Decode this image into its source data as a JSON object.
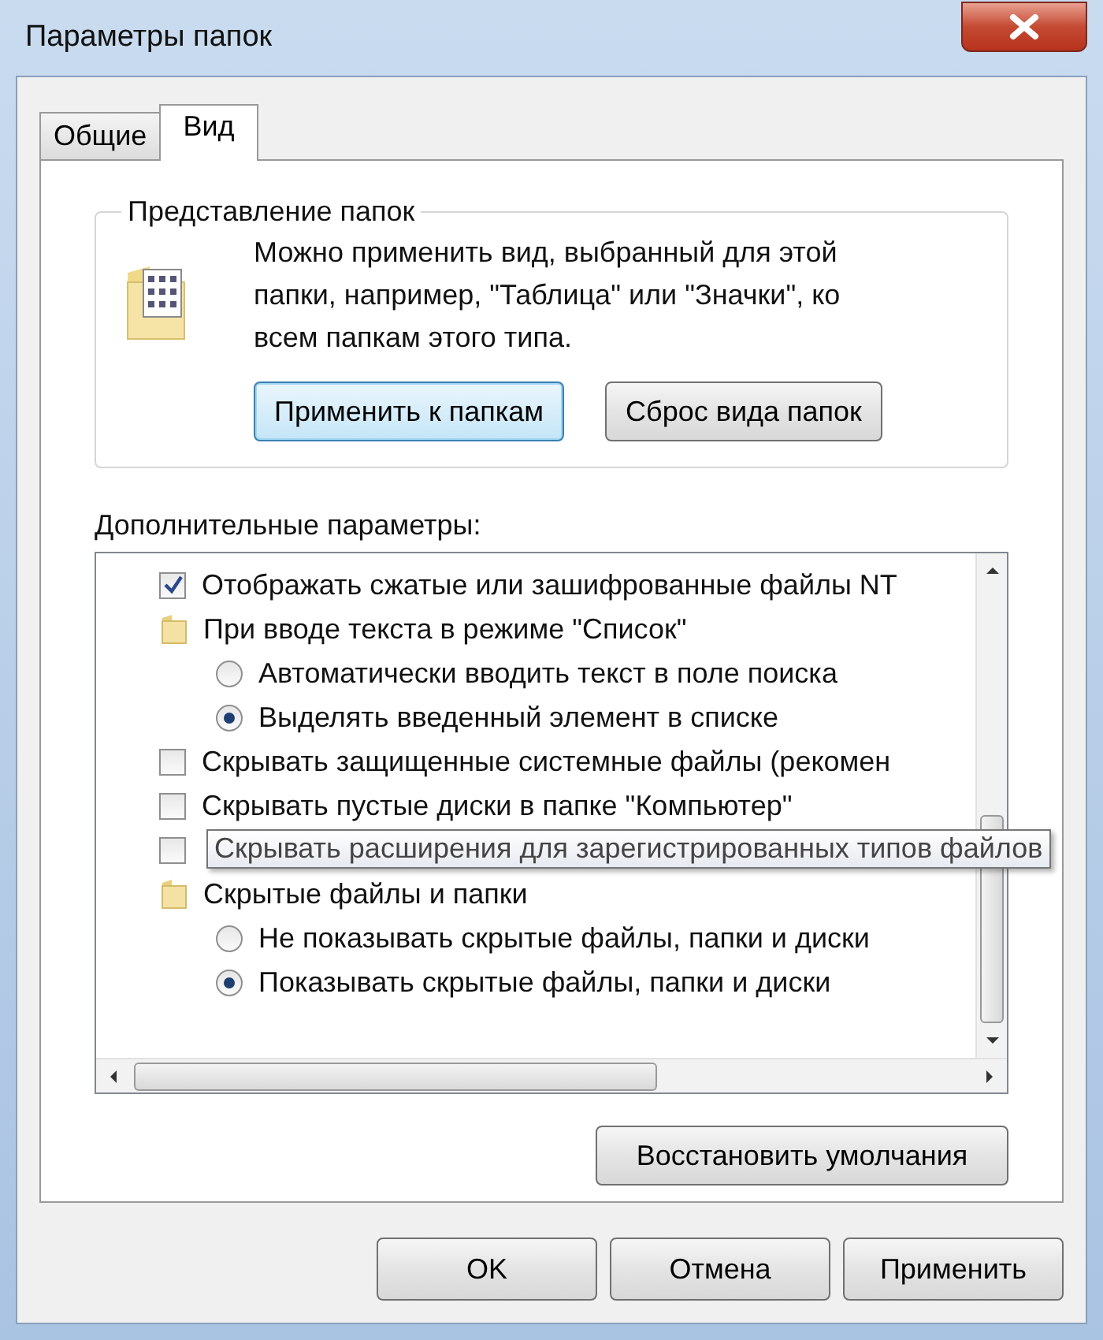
{
  "window": {
    "title": "Параметры папок"
  },
  "tabs": [
    {
      "label": "Общие",
      "selected": false
    },
    {
      "label": "Вид",
      "selected": true
    }
  ],
  "folder_views": {
    "title": "Представление папок",
    "description": "Можно применить вид, выбранный для этой папки, например, \"Таблица\" или \"Значки\", ко всем папкам этого типа.",
    "buttons": [
      {
        "label": "Применить к папкам",
        "focused": true
      },
      {
        "label": "Сброс вида папок",
        "focused": false
      }
    ]
  },
  "advanced": {
    "title": "Дополнительные параметры:",
    "items": [
      {
        "kind": "checkbox",
        "label": "Отображать сжатые или зашифрованные файлы NT",
        "checked": true
      },
      {
        "kind": "folder",
        "label": "При вводе текста в режиме \"Список\"",
        "children": [
          {
            "kind": "radio",
            "label": "Автоматически вводить текст в поле поиска",
            "selected": false
          },
          {
            "kind": "radio",
            "label": "Выделять введенный элемент в списке",
            "selected": true
          }
        ]
      },
      {
        "kind": "checkbox",
        "label": "Скрывать защищенные системные файлы (рекомен",
        "checked": false
      },
      {
        "kind": "checkbox",
        "label": "Скрывать пустые диски в папке \"Компьютер\"",
        "checked": false
      },
      {
        "kind": "checkbox",
        "label": "Скрывать расширения для зарегистрированных типов файлов",
        "checked": false,
        "tooltip": true
      },
      {
        "kind": "folder",
        "label": "Скрытые файлы и папки",
        "children": [
          {
            "kind": "radio",
            "label": "Не показывать скрытые файлы, папки и диски",
            "selected": false
          },
          {
            "kind": "radio",
            "label": "Показывать скрытые файлы, папки и диски",
            "selected": true
          }
        ]
      }
    ],
    "restore_button": "Восстановить умолчания"
  },
  "buttons": [
    "OK",
    "Отмена",
    "Применить"
  ]
}
